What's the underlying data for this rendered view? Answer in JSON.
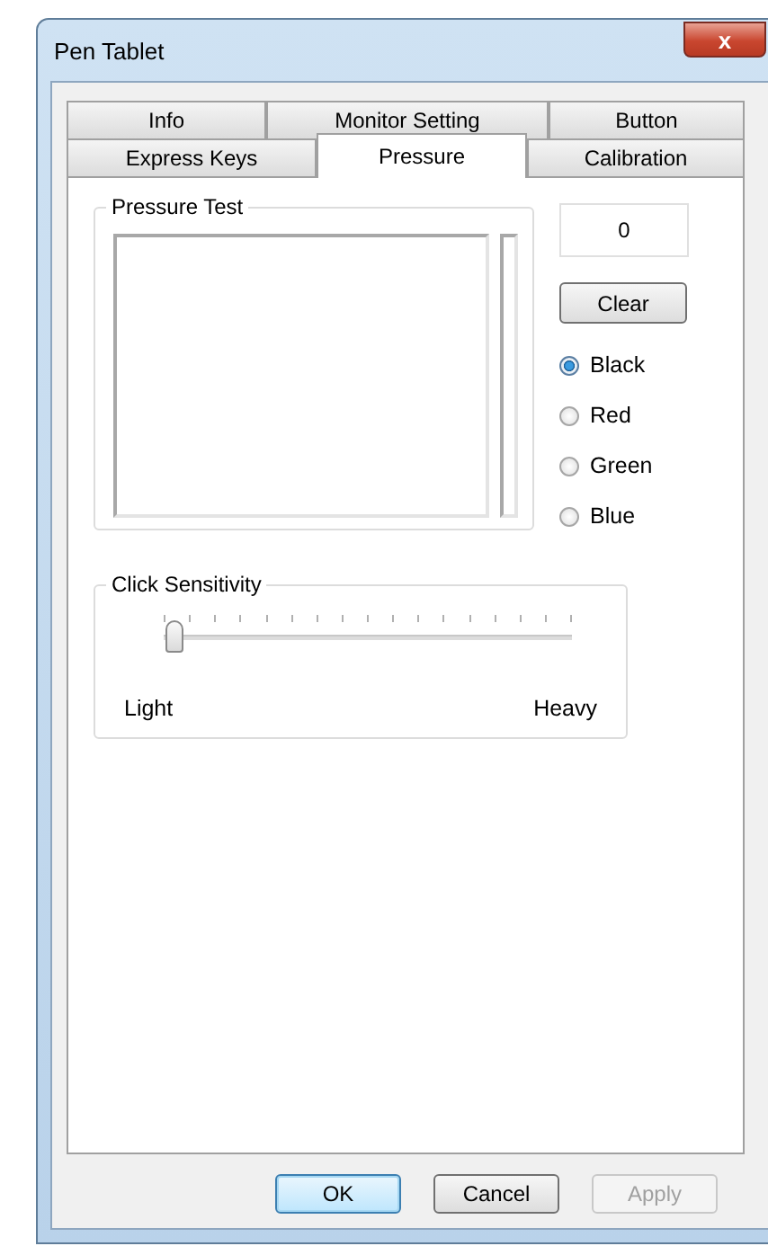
{
  "window": {
    "title": "Pen Tablet",
    "close": "x"
  },
  "tab_rows": [
    [
      {
        "label": "Info",
        "selected": false
      },
      {
        "label": "Monitor Setting",
        "selected": false
      },
      {
        "label": "Button",
        "selected": false
      }
    ],
    [
      {
        "label": "Express Keys",
        "selected": false
      },
      {
        "label": "Pressure",
        "selected": true
      },
      {
        "label": "Calibration",
        "selected": false
      }
    ]
  ],
  "pressure_test": {
    "title": "Pressure Test",
    "value": "0",
    "clear": "Clear"
  },
  "colors": [
    {
      "label": "Black",
      "selected": true
    },
    {
      "label": "Red",
      "selected": false
    },
    {
      "label": "Green",
      "selected": false
    },
    {
      "label": "Blue",
      "selected": false
    }
  ],
  "click_sensitivity": {
    "title": "Click Sensitivity",
    "level": 0.0,
    "min_label": "Light",
    "max_label": "Heavy"
  },
  "buttons": [
    {
      "label": "OK",
      "default": true,
      "disabled": false
    },
    {
      "label": "Cancel",
      "default": false,
      "disabled": false
    },
    {
      "label": "Apply",
      "default": false,
      "disabled": true
    }
  ]
}
